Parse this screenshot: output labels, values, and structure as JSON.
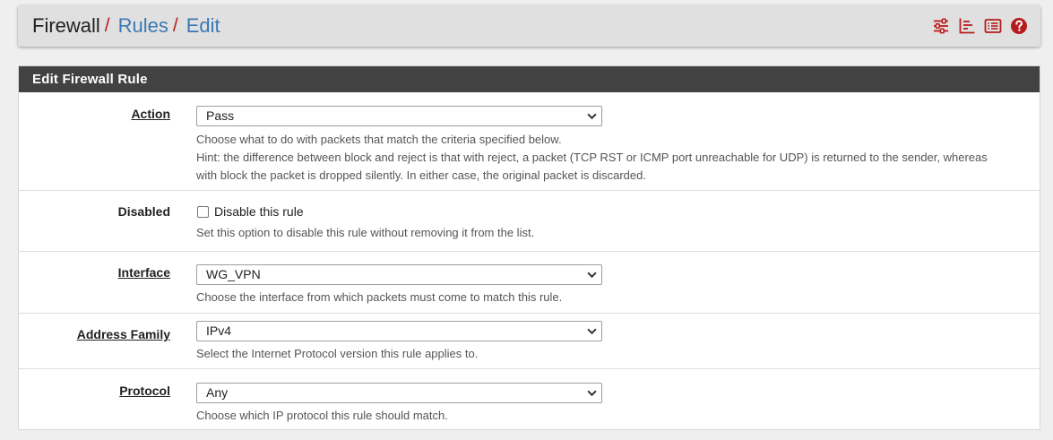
{
  "breadcrumb": {
    "root": "Firewall",
    "sep": "/",
    "items": [
      "Rules",
      "Edit"
    ]
  },
  "toolbar": {
    "icons": [
      "sliders-icon",
      "log-icon",
      "list-icon",
      "help-icon"
    ],
    "accent_color": "#b71c1c"
  },
  "panel": {
    "title": "Edit Firewall Rule",
    "header_color": "#424242"
  },
  "fields": {
    "action": {
      "label": "Action",
      "value": "Pass",
      "help": [
        "Choose what to do with packets that match the criteria specified below.",
        "Hint: the difference between block and reject is that with reject, a packet (TCP RST or ICMP port unreachable for UDP) is returned to the sender, whereas with block the packet is dropped silently. In either case, the original packet is discarded."
      ]
    },
    "disabled": {
      "label": "Disabled",
      "checkbox_label": "Disable this rule",
      "checked": false,
      "help": "Set this option to disable this rule without removing it from the list."
    },
    "interface": {
      "label": "Interface",
      "value": "WG_VPN",
      "help": "Choose the interface from which packets must come to match this rule."
    },
    "address_family": {
      "label": "Address Family",
      "value": "IPv4",
      "help": "Select the Internet Protocol version this rule applies to."
    },
    "protocol": {
      "label": "Protocol",
      "value": "Any",
      "help": "Choose which IP protocol this rule should match."
    }
  }
}
